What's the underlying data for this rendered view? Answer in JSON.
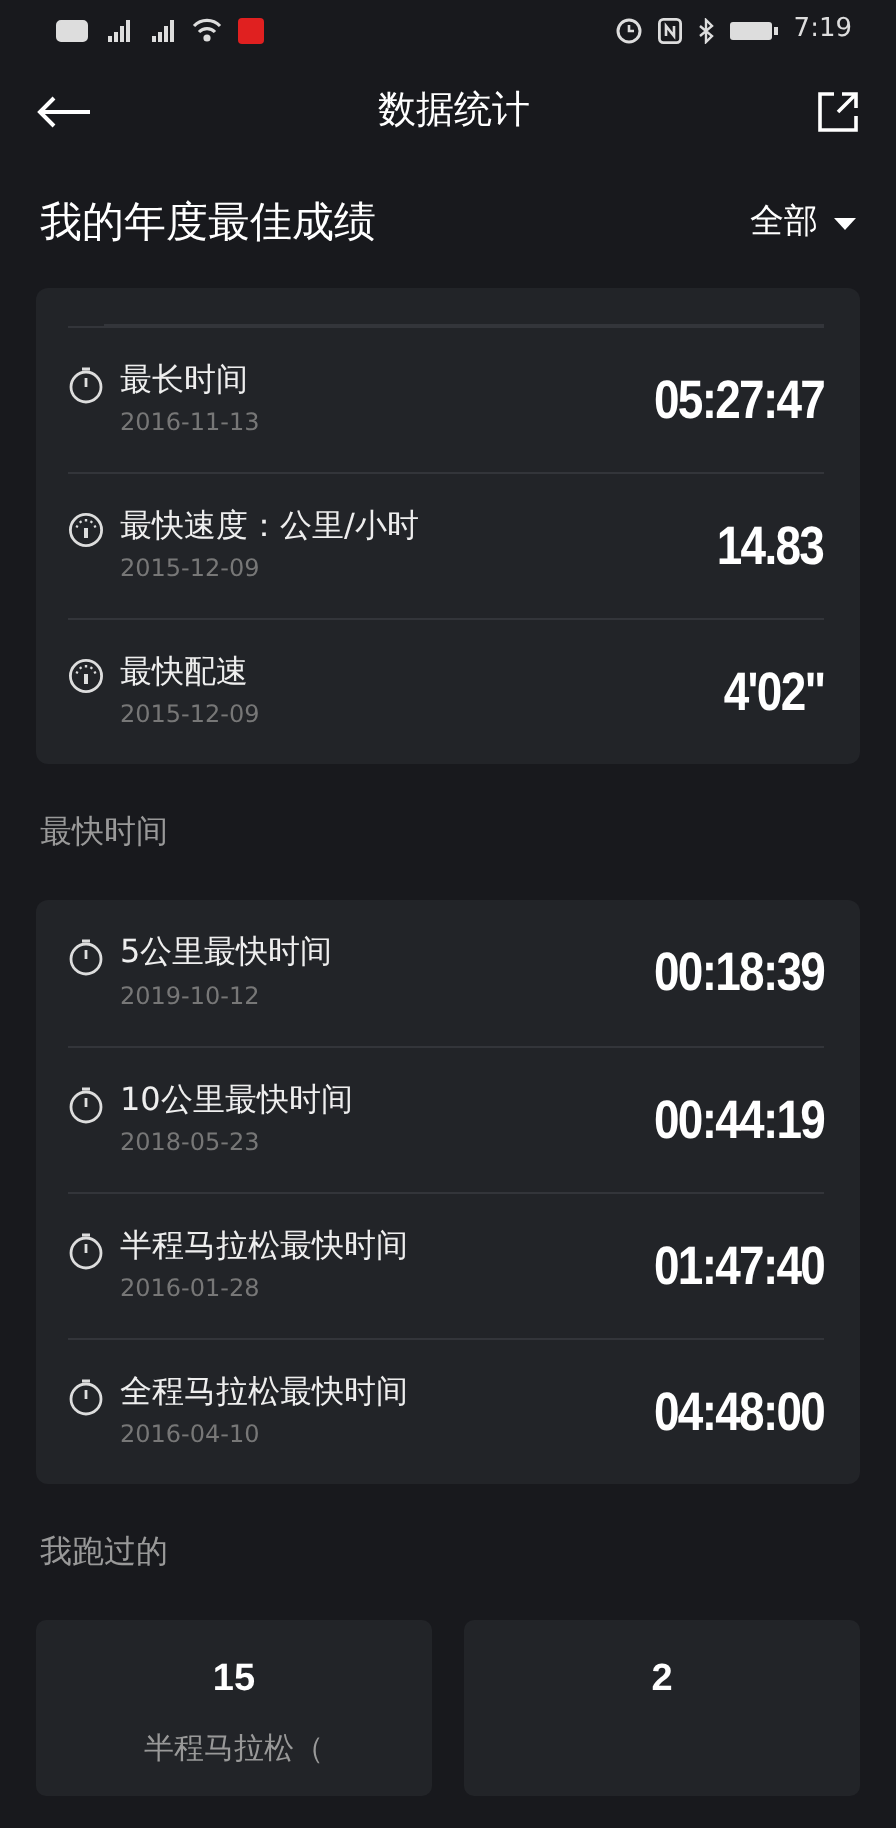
{
  "status_bar": {
    "time": "7:19"
  },
  "header": {
    "title": "数据统计"
  },
  "section": {
    "title": "我的年度最佳成绩",
    "filter": "全部"
  },
  "best_records": [
    {
      "kind": "stopwatch",
      "label": "最长时间",
      "date": "2016-11-13",
      "value": "05:27:47"
    },
    {
      "kind": "gauge",
      "label": "最快速度：公里/小时",
      "date": "2015-12-09",
      "value": "14.83"
    },
    {
      "kind": "gauge",
      "label": "最快配速",
      "date": "2015-12-09",
      "value": "4'02\""
    }
  ],
  "fastest": {
    "title": "最快时间",
    "items": [
      {
        "kind": "stopwatch",
        "label": "5公里最快时间",
        "date": "2019-10-12",
        "value": "00:18:39"
      },
      {
        "kind": "stopwatch",
        "label": "10公里最快时间",
        "date": "2018-05-23",
        "value": "00:44:19"
      },
      {
        "kind": "stopwatch",
        "label": "半程马拉松最快时间",
        "date": "2016-01-28",
        "value": "01:47:40"
      },
      {
        "kind": "stopwatch",
        "label": "全程马拉松最快时间",
        "date": "2016-04-10",
        "value": "04:48:00"
      }
    ]
  },
  "ran": {
    "title": "我跑过的",
    "tiles": [
      {
        "count": "15",
        "label": "半程马拉松（"
      },
      {
        "count": "2"
      }
    ]
  }
}
